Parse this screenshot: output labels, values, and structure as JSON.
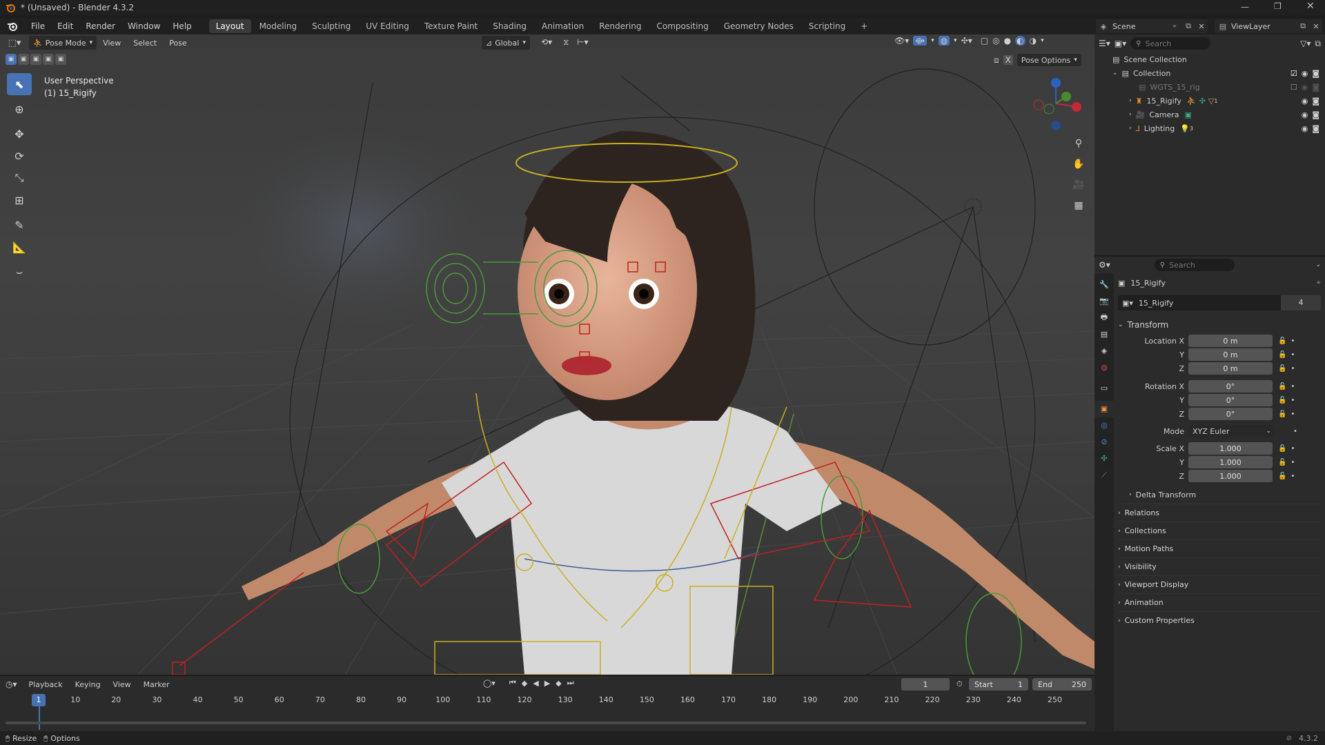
{
  "title": "* (Unsaved) - Blender 4.3.2",
  "menu": [
    "File",
    "Edit",
    "Render",
    "Window",
    "Help"
  ],
  "workspaces": [
    "Layout",
    "Modeling",
    "Sculpting",
    "UV Editing",
    "Texture Paint",
    "Shading",
    "Animation",
    "Rendering",
    "Compositing",
    "Geometry Nodes",
    "Scripting"
  ],
  "scene": {
    "label": "Scene",
    "view_layer": "ViewLayer"
  },
  "viewport": {
    "mode": "Pose Mode",
    "menus": [
      "View",
      "Select",
      "Pose"
    ],
    "orientation": "Global",
    "overlay_title": "User Perspective",
    "overlay_object": "(1) 15_Rigify",
    "pose_options": "Pose Options",
    "accent": "#4772b3"
  },
  "outliner": {
    "search_placeholder": "Search",
    "scene_collection": "Scene Collection",
    "collection": "Collection",
    "items": [
      "WGTS_15_rig",
      "15_Rigify",
      "Camera",
      "Lighting"
    ],
    "badge_rig": "1",
    "badge_lighting": "3"
  },
  "properties": {
    "search_placeholder": "Search",
    "object_name": "15_Rigify",
    "datablock": "15_Rigify",
    "users": "4",
    "transform_label": "Transform",
    "location_label": "Location X",
    "y_label": "Y",
    "z_label": "Z",
    "rotation_label": "Rotation X",
    "scale_label": "Scale X",
    "mode_label": "Mode",
    "mode_value": "XYZ Euler",
    "location": [
      "0 m",
      "0 m",
      "0 m"
    ],
    "rotation": [
      "0°",
      "0°",
      "0°"
    ],
    "scale": [
      "1.000",
      "1.000",
      "1.000"
    ],
    "delta": "Delta Transform",
    "panels": [
      "Relations",
      "Collections",
      "Motion Paths",
      "Visibility",
      "Viewport Display",
      "Animation",
      "Custom Properties"
    ]
  },
  "timeline": {
    "menus": [
      "Playback",
      "Keying",
      "View",
      "Marker"
    ],
    "current_frame": "1",
    "start_label": "Start",
    "start": "1",
    "end_label": "End",
    "end": "250",
    "ticks": [
      "1",
      "10",
      "20",
      "30",
      "40",
      "50",
      "60",
      "70",
      "80",
      "90",
      "100",
      "110",
      "120",
      "130",
      "140",
      "150",
      "160",
      "170",
      "180",
      "190",
      "200",
      "210",
      "220",
      "230",
      "240",
      "250"
    ]
  },
  "status": {
    "left1": "Resize",
    "left2": "Options",
    "version": "4.3.2"
  }
}
